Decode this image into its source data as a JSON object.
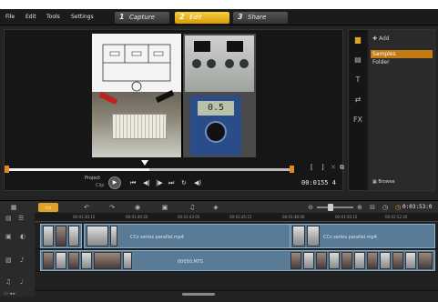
{
  "menu": {
    "file": "File",
    "edit": "Edit",
    "tools": "Tools",
    "settings": "Settings"
  },
  "steps": [
    {
      "num": "1",
      "label": "Capture"
    },
    {
      "num": "2",
      "label": "Edit"
    },
    {
      "num": "3",
      "label": "Share"
    }
  ],
  "player": {
    "project_label": "Project",
    "clip_label": "Clip",
    "timecode": "00:0155 4",
    "multimeter_reading": "0.5"
  },
  "library": {
    "add_label": "Add",
    "items": [
      "Samples",
      "Folder"
    ],
    "browse_label": "Browse"
  },
  "timeline": {
    "timecode": "0:03:53:0",
    "ruler_ticks": [
      "00:01:30:10",
      "00:01:40:20",
      "00:01:43:05",
      "00:01:45:15",
      "00:01:48:00",
      "00:01:50:10",
      "00:01:52:20"
    ],
    "video_clips": [
      "CCs series parallel.mp4",
      "CCs series parallel.mp4"
    ],
    "audio_clip": "00050.MTS"
  },
  "colors": {
    "accent": "#e0a12a",
    "clip_blue": "#5a7b95",
    "playhead": "#e58a1a"
  },
  "scrub_progress": 0.5
}
